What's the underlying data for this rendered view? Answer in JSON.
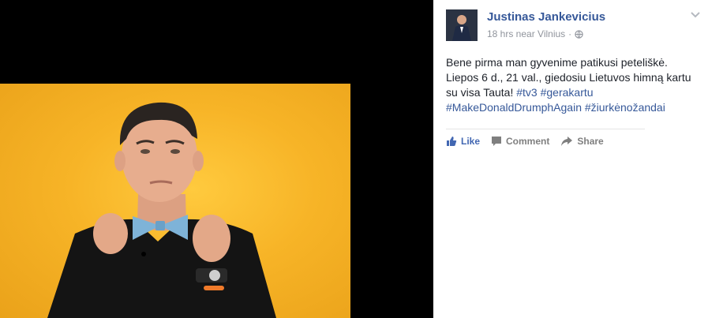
{
  "post": {
    "author": "Justinas Jankevicius",
    "time": "18 hrs near Vilnius",
    "separator": "·",
    "text_lines": [
      {
        "plain": "Bene pirma man gyvenime patikusi peteliškė."
      },
      {
        "plain": "Liepos 6 d., 21 val., giedosiu Lietuvos himną kartu"
      },
      {
        "plain": "su visa Tauta! ",
        "tags": "#tv3 #gerakartu"
      },
      {
        "tags": "#MakeDonaldDrumphAgain #žiurkėnožandai"
      }
    ]
  },
  "actions": {
    "like": "Like",
    "comment": "Comment",
    "share": "Share"
  },
  "icons": {
    "privacy": "globe-icon",
    "menu": "chevron-down-icon",
    "like": "thumbs-up-icon",
    "comment": "speech-bubble-icon",
    "share": "share-arrow-icon"
  },
  "colors": {
    "link": "#365899",
    "like": "#4267b2",
    "meta": "#90949c",
    "photo_bg": "#f7b427"
  }
}
